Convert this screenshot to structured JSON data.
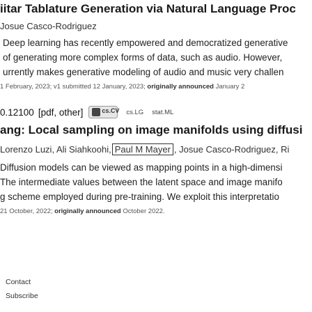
{
  "paper1": {
    "title": "iitar Tablature Generation via Natural Language Proc",
    "author": "Josue Casco-Rodriguez",
    "abstract_lines": [
      "Deep learning has recently empowered and democratized generative",
      " of generating more complex forms of data, such as audio. However,",
      "urrently makes generative modeling of audio and music very challen"
    ],
    "dates": {
      "text": "1 February, 2023; v1 submitted 12 January, 2023;",
      "bold": "originally announced",
      "tail": "January 2"
    }
  },
  "paper2": {
    "arxiv_id": "0.12100",
    "formats": "[pdf, other]",
    "badge_label": "cs.CV",
    "tags": [
      "cs.LG",
      "stat.ML"
    ],
    "title": "ang: Local sampling on image manifolds using diffusi",
    "authors_before": "Lorenzo Luzi, Ali Siahkoohi,",
    "authors_highlight": "Paul M Mayer",
    "authors_after": ", Josue Casco-Rodriguez, Ri",
    "abstract_lines": [
      "Diffusion models can be viewed as mapping points in a high-dimensi",
      "The intermediate values between the latent space and image manifo",
      "g scheme employed during pre-training. We exploit this interpretatio"
    ],
    "dates": {
      "text": "21 October, 2022;",
      "bold": "originally announced",
      "tail": "October 2022."
    }
  },
  "footer": {
    "contact": "Contact",
    "subscribe": "Subscribe"
  }
}
